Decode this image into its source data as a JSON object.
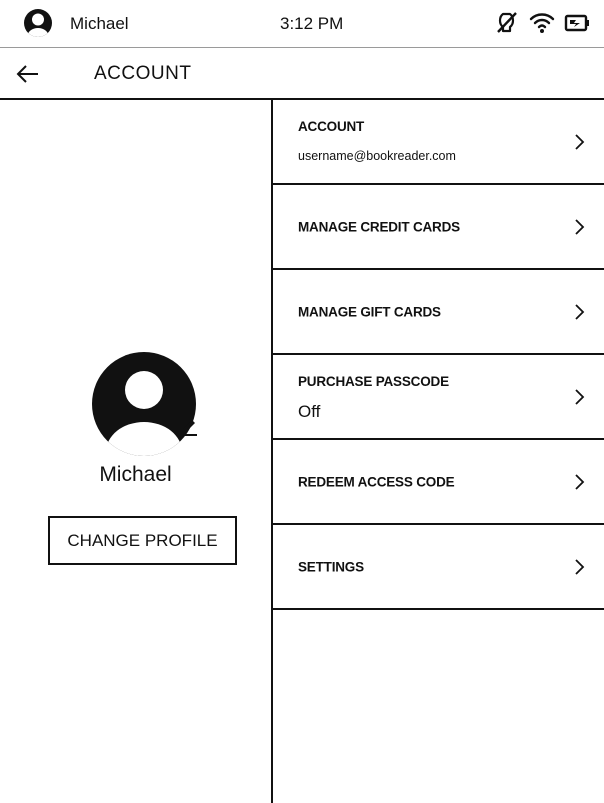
{
  "status_bar": {
    "user_name": "Michael",
    "time": "3:12 PM",
    "icons": [
      "user-avatar-icon",
      "light-off-icon",
      "wifi-icon",
      "battery-charging-icon"
    ]
  },
  "header": {
    "title": "ACCOUNT",
    "back_icon": "arrow-left-icon"
  },
  "profile": {
    "name": "Michael",
    "change_button_label": "CHANGE PROFILE",
    "edit_icon": "pencil-icon"
  },
  "menu": {
    "items": [
      {
        "label": "ACCOUNT",
        "subtitle": "username@bookreader.com"
      },
      {
        "label": "MANAGE CREDIT CARDS"
      },
      {
        "label": "MANAGE GIFT CARDS"
      },
      {
        "label": "PURCHASE PASSCODE",
        "subtitle": "Off"
      },
      {
        "label": "REDEEM ACCESS CODE"
      },
      {
        "label": "SETTINGS"
      }
    ],
    "chevron_icon": "chevron-right-icon"
  },
  "colors": {
    "foreground": "#111111",
    "background": "#ffffff",
    "divider": "#9a9a9a"
  }
}
